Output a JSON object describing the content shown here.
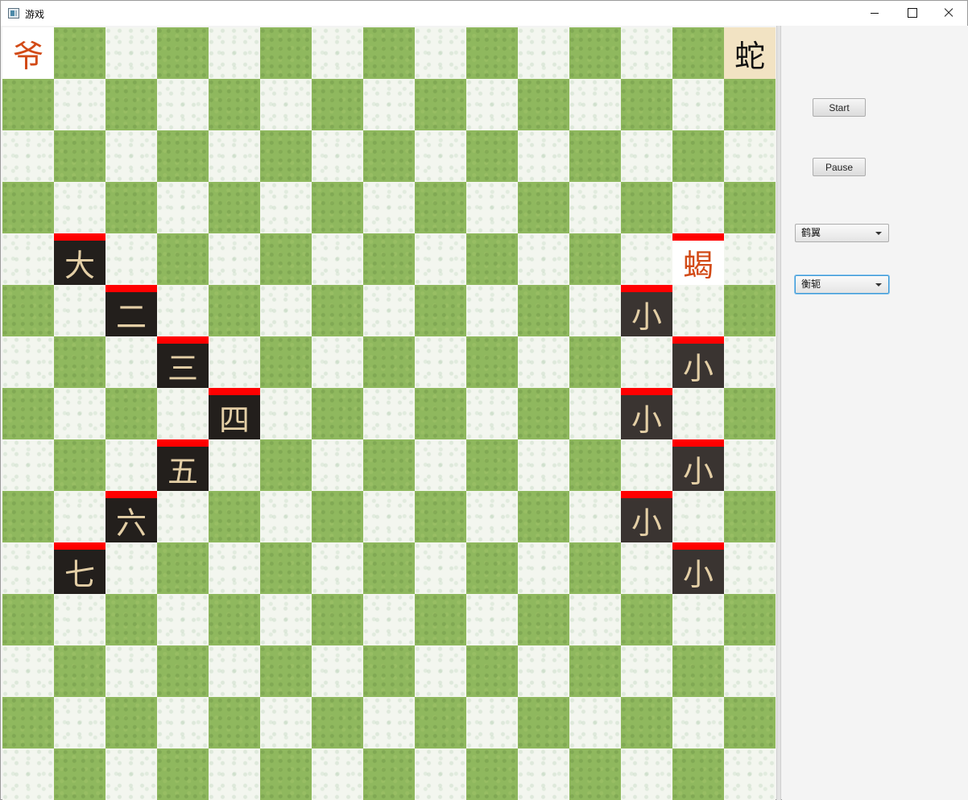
{
  "window": {
    "title": "游戏"
  },
  "board": {
    "grid_size": 15,
    "corner_pieces": [
      {
        "label": "爷",
        "row": 0,
        "col": 0,
        "style": "white"
      },
      {
        "label": "蛇",
        "row": 0,
        "col": 14,
        "style": "parchment"
      }
    ],
    "left_team": [
      {
        "label": "大",
        "row": 4,
        "col": 1
      },
      {
        "label": "二",
        "row": 5,
        "col": 2
      },
      {
        "label": "三",
        "row": 6,
        "col": 3
      },
      {
        "label": "四",
        "row": 7,
        "col": 4
      },
      {
        "label": "五",
        "row": 8,
        "col": 3
      },
      {
        "label": "六",
        "row": 9,
        "col": 2
      },
      {
        "label": "七",
        "row": 10,
        "col": 1
      }
    ],
    "right_team": [
      {
        "label": "蝎",
        "row": 4,
        "col": 13,
        "style": "white"
      },
      {
        "label": "小",
        "row": 5,
        "col": 12
      },
      {
        "label": "小",
        "row": 6,
        "col": 13
      },
      {
        "label": "小",
        "row": 7,
        "col": 12
      },
      {
        "label": "小",
        "row": 8,
        "col": 13
      },
      {
        "label": "小",
        "row": 9,
        "col": 12
      },
      {
        "label": "小",
        "row": 10,
        "col": 13
      }
    ],
    "health_bar_color": "#ff0000",
    "light_tile_color": "#f3f6ef",
    "dark_tile_color": "#8fb85e"
  },
  "controls": {
    "start_label": "Start",
    "pause_label": "Pause",
    "formation_1": "鹤翼",
    "formation_2": "衡轭"
  }
}
